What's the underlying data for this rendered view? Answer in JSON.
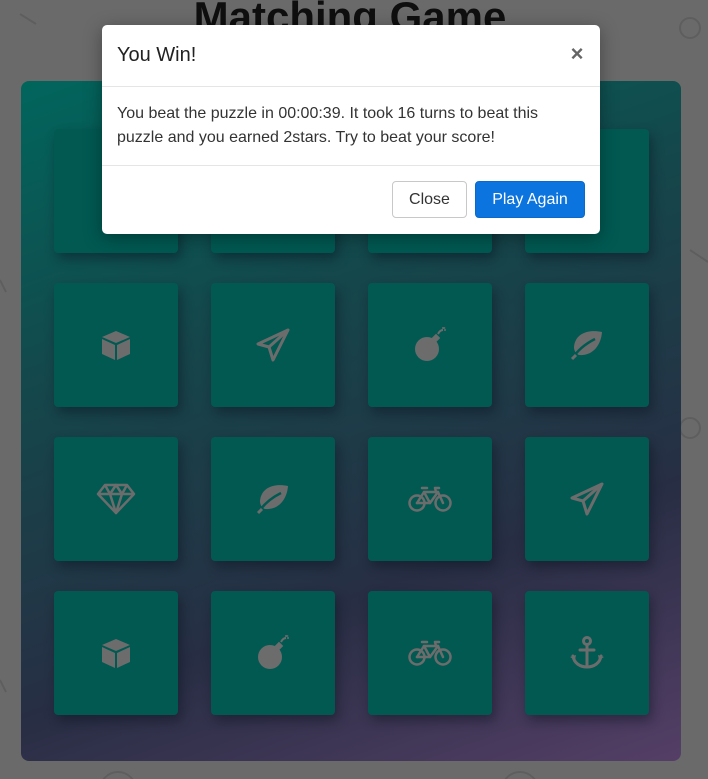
{
  "game": {
    "title": "Matching Game"
  },
  "deck": {
    "cards": [
      {
        "icon": "hidden-icon"
      },
      {
        "icon": "hidden-icon"
      },
      {
        "icon": "hidden-icon"
      },
      {
        "icon": "hidden-icon"
      },
      {
        "icon": "cube-icon"
      },
      {
        "icon": "paper-plane-icon"
      },
      {
        "icon": "bomb-icon"
      },
      {
        "icon": "leaf-icon"
      },
      {
        "icon": "diamond-icon"
      },
      {
        "icon": "leaf-icon"
      },
      {
        "icon": "bicycle-icon"
      },
      {
        "icon": "paper-plane-icon"
      },
      {
        "icon": "cube-icon"
      },
      {
        "icon": "bomb-icon"
      },
      {
        "icon": "bicycle-icon"
      },
      {
        "icon": "anchor-icon"
      }
    ],
    "card_color": "#02b3a4",
    "icon_color": "#d8d8d8"
  },
  "modal": {
    "title": "You Win!",
    "close_symbol": "×",
    "message": "You beat the puzzle in 00:00:39. It took 16 turns to beat this puzzle and you earned 2stars. Try to beat your score!",
    "close_label": "Close",
    "play_again_label": "Play Again",
    "primary_color": "#0b74de"
  }
}
